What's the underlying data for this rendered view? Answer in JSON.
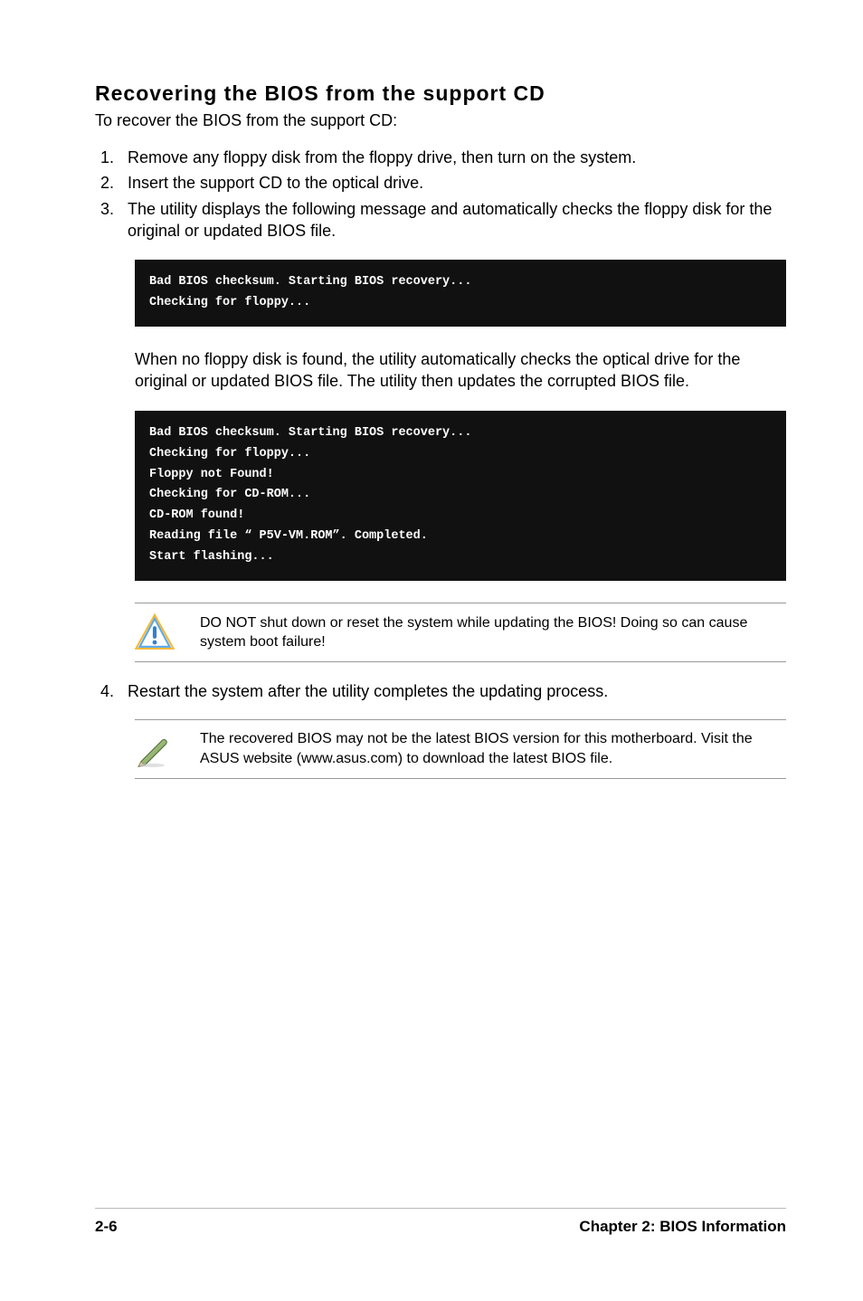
{
  "heading": "Recovering the BIOS from the support CD",
  "intro": "To recover the BIOS from the support CD:",
  "step1": "Remove any floppy disk from the floppy drive, then turn on the system.",
  "step2": "Insert the support CD to the optical drive.",
  "step3": "The utility displays the following message and automatically checks the floppy disk for the original or updated BIOS file.",
  "term1_l1": "Bad BIOS checksum. Starting BIOS recovery...",
  "term1_l2": "Checking for floppy...",
  "sub_para": "When no floppy disk is found, the utility automatically checks the optical drive for the original or updated BIOS file. The utility then updates the corrupted BIOS file.",
  "term2_l1": "Bad BIOS checksum. Starting BIOS recovery...",
  "term2_l2": "Checking for floppy...",
  "term2_l3": "Floppy not Found!",
  "term2_l4": "Checking for CD-ROM...",
  "term2_l5": "CD-ROM found!",
  "term2_l6": "Reading file “ P5V-VM.ROM”. Completed.",
  "term2_l7": "Start flashing...",
  "warn_text": "DO NOT shut down or reset the system while updating the BIOS! Doing so can cause system boot failure!",
  "step4": "Restart the system after the utility completes the updating process.",
  "note_text": "The recovered BIOS may not be the latest BIOS version for this motherboard. Visit the ASUS website (www.asus.com) to download the latest BIOS file.",
  "footer_left": "2-6",
  "footer_right": "Chapter 2: BIOS Information"
}
